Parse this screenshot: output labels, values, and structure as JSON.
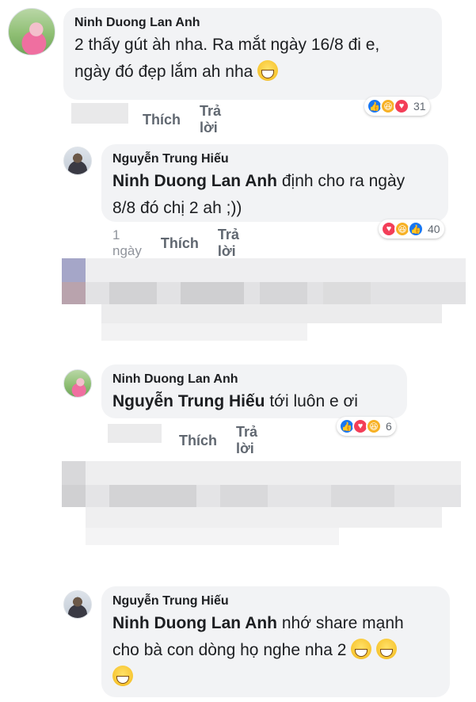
{
  "comments": [
    {
      "author": "Ninh Duong Lan Anh",
      "text_line1": "2 thấy gút àh nha. Ra mắt ngày 16/8 đi e,",
      "text_line2": "ngày đó đẹp lắm ah nha",
      "actions": {
        "like": "Thích",
        "reply": "Trả lời"
      },
      "reactions": {
        "icons": [
          "like-icon",
          "haha-icon",
          "love-icon"
        ],
        "count": "31"
      }
    },
    {
      "author": "Nguyễn Trung Hiếu",
      "mention": "Ninh Duong Lan Anh",
      "text_line1": " định cho ra ngày",
      "text_line2": "8/8 đó chị 2 ah ;))",
      "actions": {
        "time": "1 ngày",
        "like": "Thích",
        "reply": "Trả lời"
      },
      "reactions": {
        "icons": [
          "love-icon",
          "haha-icon",
          "like-icon"
        ],
        "count": "40"
      }
    },
    {
      "author": "Ninh Duong Lan Anh",
      "mention": "Nguyễn Trung Hiếu",
      "text_line1": "  tới luôn e ơi",
      "actions": {
        "like": "Thích",
        "reply": "Trả lời"
      },
      "reactions": {
        "icons": [
          "like-icon",
          "love-icon",
          "haha-icon"
        ],
        "count": "6"
      }
    },
    {
      "author": "Nguyễn Trung Hiếu",
      "mention": "Ninh Duong Lan Anh",
      "text_line1": " nhớ share mạnh",
      "text_line2": "cho bà con dòng họ nghe nha 2"
    }
  ],
  "colors": {
    "bubble": "#f2f3f5",
    "link": "#385898",
    "like": "#1877f2",
    "love": "#f33e58",
    "haha": "#f7b125"
  }
}
